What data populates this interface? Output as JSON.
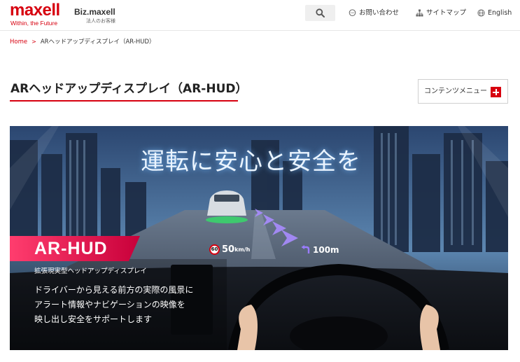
{
  "header": {
    "logo": {
      "word": "maxell",
      "tagline": "Within, the Future"
    },
    "biz": {
      "title": "Biz.maxell",
      "subtitle": "法人のお客様"
    },
    "nav": {
      "contact": "お問い合わせ",
      "sitemap": "サイトマップ",
      "english": "English"
    }
  },
  "breadcrumb": {
    "home": "Home",
    "separator": ">",
    "current": "ARヘッドアップディスプレイ（AR-HUD）"
  },
  "page": {
    "title": "ARヘッドアップディスプレイ（AR-HUD）",
    "content_menu_label": "コンテンツメニュー"
  },
  "hero": {
    "headline": "運転に安心と安全を",
    "speed_limit": "60",
    "speed_value": "50",
    "speed_unit": "km/h",
    "distance": "100m",
    "badge": "AR-HUD",
    "subtitle": "拡張現実型ヘッドアップディスプレイ",
    "description": [
      "ドライバーから見える前方の実際の風景に",
      "アラート情報やナビゲーションの映像を",
      "映し出し安全をサポートします"
    ]
  },
  "colors": {
    "brand": "#d7000f",
    "text": "#222222",
    "hero_bg": "#1a2a45",
    "badge_gradient_start": "#ff3d6e",
    "badge_gradient_end": "#c8003a"
  },
  "icons": {
    "search": "search-icon",
    "contact": "chat-bubble-icon",
    "sitemap": "sitemap-icon",
    "english": "globe-icon",
    "content_menu": "plus-icon"
  }
}
